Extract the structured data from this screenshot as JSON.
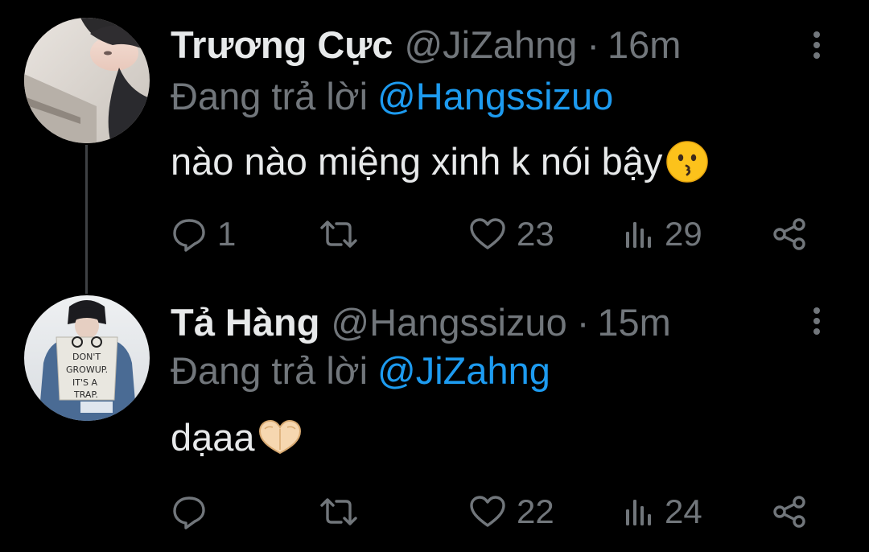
{
  "tweets": [
    {
      "display_name": "Trương Cực",
      "handle": "@JiZahng",
      "separator": "·",
      "time": "16m",
      "reply_prefix": "Đang trả lời",
      "reply_handle": "@Hangssizuo",
      "text": "nào nào miệng xinh k nói bậy",
      "emoji": "kissing-face-emoji",
      "reply_count": "1",
      "retweet_count": "",
      "like_count": "23",
      "view_count": "29"
    },
    {
      "display_name": "Tả Hàng",
      "handle": "@Hangssizuo",
      "separator": "·",
      "time": "15m",
      "reply_prefix": "Đang trả lời",
      "reply_handle": "@JiZahng",
      "text": "dạaa",
      "emoji": "heart-hands-emoji",
      "reply_count": "",
      "retweet_count": "",
      "like_count": "22",
      "view_count": "24"
    }
  ],
  "colors": {
    "background": "#000000",
    "text_primary": "#e7e9ea",
    "text_secondary": "#71767b",
    "link": "#1d9bf0",
    "thread_line": "#3e4144"
  },
  "icons": {
    "reply": "reply-icon",
    "retweet": "retweet-icon",
    "like": "heart-icon",
    "views": "views-icon",
    "share": "share-icon",
    "more": "more-vertical-icon"
  }
}
